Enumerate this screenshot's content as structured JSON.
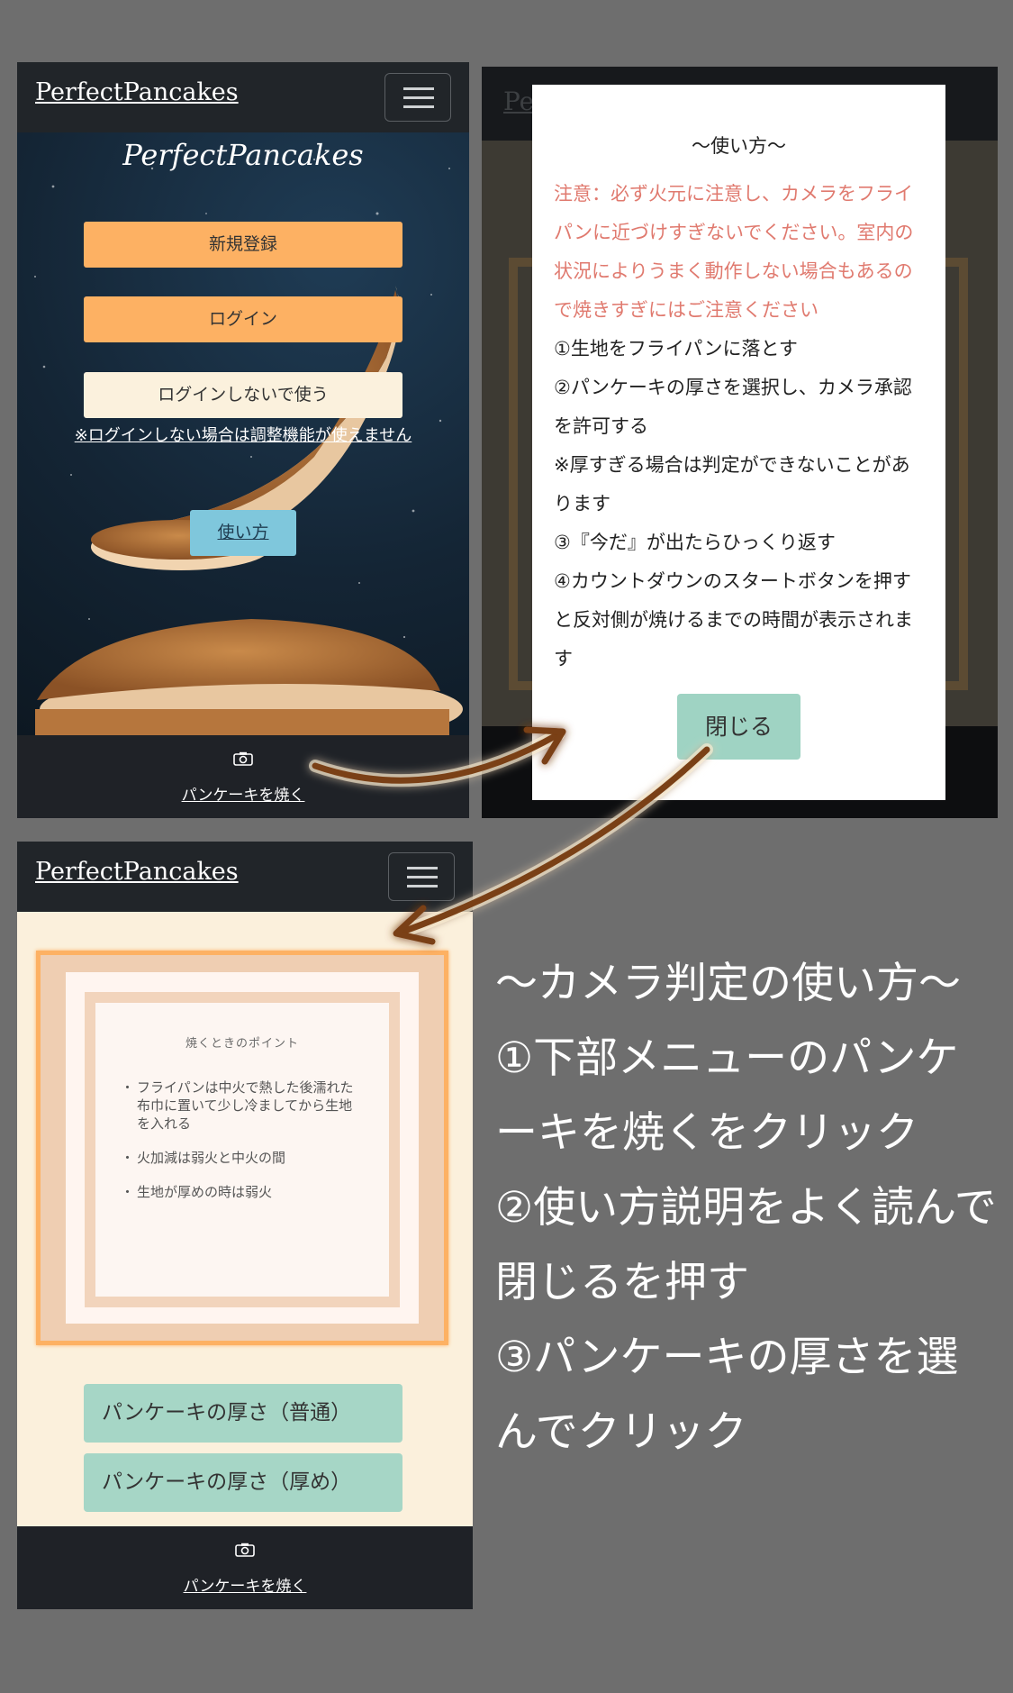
{
  "colors": {
    "navbar": "#212529",
    "accent_orange": "#fdb163",
    "accent_green": "#a6d6c6",
    "warning_red": "#e07a6f",
    "background": "#6e6e6e"
  },
  "panel1": {
    "brand": "PerfectPancakes",
    "hero_title": "PerfectPancakes",
    "register_button": "新規登録",
    "login_button": "ログイン",
    "guest_button": "ログインしないで使う",
    "guest_note": "※ログインしない場合は調整機能が使えません",
    "usage_button": "使い方",
    "footer": {
      "icon": "camera-icon",
      "label": "パンケーキを焼く"
    }
  },
  "panel2": {
    "brand": "Pe",
    "modal": {
      "title": "〜使い方〜",
      "warning": "注意：必ず火元に注意し、カメラをフライパンに近づけすぎないでください。室内の状況によりうまく動作しない場合もあるので焼きすぎにはご注意ください",
      "step1": "①生地をフライパンに落とす",
      "step2": "②パンケーキの厚さを選択し、カメラ承認を許可する",
      "note": "※厚すぎる場合は判定ができないことがあります",
      "step3": "③『今だ』が出たらひっくり返す",
      "step4": "④カウントダウンのスタートボタンを押すと反対側が焼けるまでの時間が表示されます",
      "close_button": "閉じる"
    }
  },
  "panel3": {
    "brand": "PerfectPancakes",
    "card": {
      "title": "焼くときのポイント",
      "tips": [
        "フライパンは中火で熱した後濡れた布巾に置いて少し冷ましてから生地を入れる",
        "火加減は弱火と中火の間",
        "生地が厚めの時は弱火"
      ]
    },
    "normal_button": "パンケーキの厚さ（普通）",
    "thick_button": "パンケーキの厚さ（厚め）",
    "footer": {
      "icon": "camera-icon",
      "label": "パンケーキを焼く"
    }
  },
  "instructions": {
    "title": "〜カメラ判定の使い方〜",
    "line1": "①下部メニューのパンケーキを焼くをクリック",
    "line2": "②使い方説明をよく読んで閉じるを押す",
    "line3": "③パンケーキの厚さを選んでクリック"
  }
}
